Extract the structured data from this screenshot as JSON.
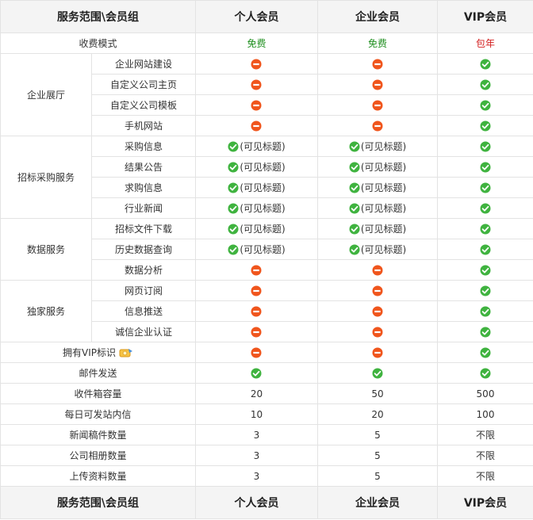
{
  "headers": [
    "服务范围\\会员组",
    "个人会员",
    "企业会员",
    "VIP会员"
  ],
  "charge": {
    "label": "收费模式",
    "values": [
      "免费",
      "免费",
      "包年"
    ]
  },
  "groups": [
    {
      "name": "企业展厅",
      "rows": [
        {
          "label": "企业网站建设",
          "cells": [
            {
              "icon": "no"
            },
            {
              "icon": "no"
            },
            {
              "icon": "yes"
            }
          ]
        },
        {
          "label": "自定义公司主页",
          "cells": [
            {
              "icon": "no"
            },
            {
              "icon": "no"
            },
            {
              "icon": "yes"
            }
          ]
        },
        {
          "label": "自定义公司模板",
          "cells": [
            {
              "icon": "no"
            },
            {
              "icon": "no"
            },
            {
              "icon": "yes"
            }
          ]
        },
        {
          "label": "手机网站",
          "cells": [
            {
              "icon": "no"
            },
            {
              "icon": "no"
            },
            {
              "icon": "yes"
            }
          ]
        }
      ]
    },
    {
      "name": "招标采购服务",
      "rows": [
        {
          "label": "采购信息",
          "cells": [
            {
              "icon": "yes",
              "text": "(可见标题)"
            },
            {
              "icon": "yes",
              "text": "(可见标题)"
            },
            {
              "icon": "yes"
            }
          ]
        },
        {
          "label": "结果公告",
          "cells": [
            {
              "icon": "yes",
              "text": "(可见标题)"
            },
            {
              "icon": "yes",
              "text": "(可见标题)"
            },
            {
              "icon": "yes"
            }
          ]
        },
        {
          "label": "求购信息",
          "cells": [
            {
              "icon": "yes",
              "text": "(可见标题)"
            },
            {
              "icon": "yes",
              "text": "(可见标题)"
            },
            {
              "icon": "yes"
            }
          ]
        },
        {
          "label": "行业新闻",
          "cells": [
            {
              "icon": "yes",
              "text": "(可见标题)"
            },
            {
              "icon": "yes",
              "text": "(可见标题)"
            },
            {
              "icon": "yes"
            }
          ]
        }
      ]
    },
    {
      "name": "数据服务",
      "rows": [
        {
          "label": "招标文件下载",
          "cells": [
            {
              "icon": "yes",
              "text": "(可见标题)"
            },
            {
              "icon": "yes",
              "text": "(可见标题)"
            },
            {
              "icon": "yes"
            }
          ]
        },
        {
          "label": "历史数据查询",
          "cells": [
            {
              "icon": "yes",
              "text": "(可见标题)"
            },
            {
              "icon": "yes",
              "text": "(可见标题)"
            },
            {
              "icon": "yes"
            }
          ]
        },
        {
          "label": "数据分析",
          "cells": [
            {
              "icon": "no"
            },
            {
              "icon": "no"
            },
            {
              "icon": "yes"
            }
          ]
        }
      ]
    },
    {
      "name": "独家服务",
      "rows": [
        {
          "label": "网页订阅",
          "cells": [
            {
              "icon": "no"
            },
            {
              "icon": "no"
            },
            {
              "icon": "yes"
            }
          ]
        },
        {
          "label": "信息推送",
          "cells": [
            {
              "icon": "no"
            },
            {
              "icon": "no"
            },
            {
              "icon": "yes"
            }
          ]
        },
        {
          "label": "诚信企业认证",
          "cells": [
            {
              "icon": "no"
            },
            {
              "icon": "no"
            },
            {
              "icon": "yes"
            }
          ]
        }
      ]
    }
  ],
  "single_rows": [
    {
      "label": "拥有VIP标识",
      "badge": true,
      "cells": [
        {
          "icon": "no"
        },
        {
          "icon": "no"
        },
        {
          "icon": "yes"
        }
      ]
    },
    {
      "label": "邮件发送",
      "cells": [
        {
          "icon": "yes"
        },
        {
          "icon": "yes"
        },
        {
          "icon": "yes"
        }
      ]
    },
    {
      "label": "收件箱容量",
      "cells": [
        {
          "text": "20"
        },
        {
          "text": "50"
        },
        {
          "text": "500"
        }
      ]
    },
    {
      "label": "每日可发站内信",
      "cells": [
        {
          "text": "10"
        },
        {
          "text": "20"
        },
        {
          "text": "100"
        }
      ]
    },
    {
      "label": "新闻稿件数量",
      "cells": [
        {
          "text": "3"
        },
        {
          "text": "5"
        },
        {
          "text": "不限"
        }
      ]
    },
    {
      "label": "公司相册数量",
      "cells": [
        {
          "text": "3"
        },
        {
          "text": "5"
        },
        {
          "text": "不限"
        }
      ]
    },
    {
      "label": "上传资料数量",
      "cells": [
        {
          "text": "3"
        },
        {
          "text": "5"
        },
        {
          "text": "不限"
        }
      ]
    }
  ],
  "icons": {
    "yes": "check-circle-icon",
    "no": "minus-circle-icon",
    "badge": "vip-badge-icon"
  },
  "colors": {
    "yes": "#3fb33f",
    "no": "#f0551c",
    "free": "#1f8f1f",
    "annual": "#d21c1c"
  }
}
